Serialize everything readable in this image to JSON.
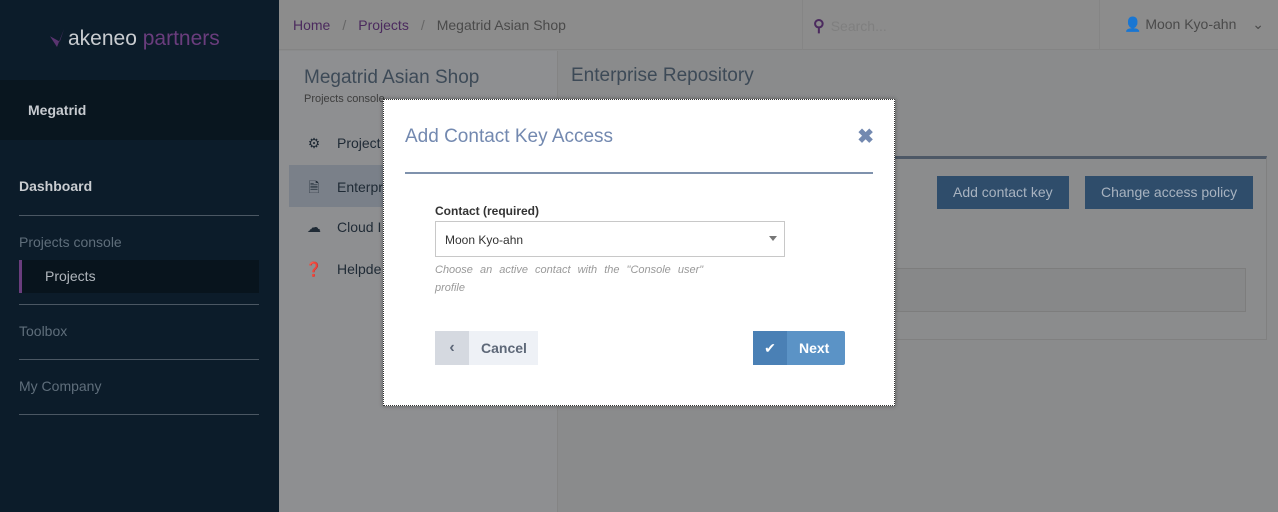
{
  "brand": {
    "name": "akeneo",
    "suffix": "partners"
  },
  "sidebar": {
    "org": "Megatrid",
    "items": [
      {
        "label": "Dashboard"
      },
      {
        "label": "Projects console"
      },
      {
        "label": "Projects"
      },
      {
        "label": "Toolbox"
      },
      {
        "label": "My Company"
      }
    ]
  },
  "header": {
    "breadcrumb": [
      "Home",
      "Projects",
      "Megatrid Asian Shop"
    ],
    "search_placeholder": "Search...",
    "user": "Moon Kyo-ahn"
  },
  "project": {
    "title": "Megatrid Asian Shop",
    "subtitle": "Projects console",
    "menu": [
      {
        "label": "Project",
        "icon": "cogs-icon"
      },
      {
        "label": "Enterpr",
        "icon": "file-icon"
      },
      {
        "label": "Cloud I",
        "icon": "cloud-icon"
      },
      {
        "label": "Helpde",
        "icon": "question-icon"
      }
    ]
  },
  "content": {
    "title": "Enterprise Repository",
    "add_button": "Add contact key",
    "policy_button": "Change access policy"
  },
  "modal": {
    "title": "Add Contact Key Access",
    "close": "✖",
    "field_label": "Contact (required)",
    "field_value": "Moon Kyo-ahn",
    "help": "Choose an active contact with the \"Console user\" profile",
    "cancel": "Cancel",
    "next": "Next"
  }
}
